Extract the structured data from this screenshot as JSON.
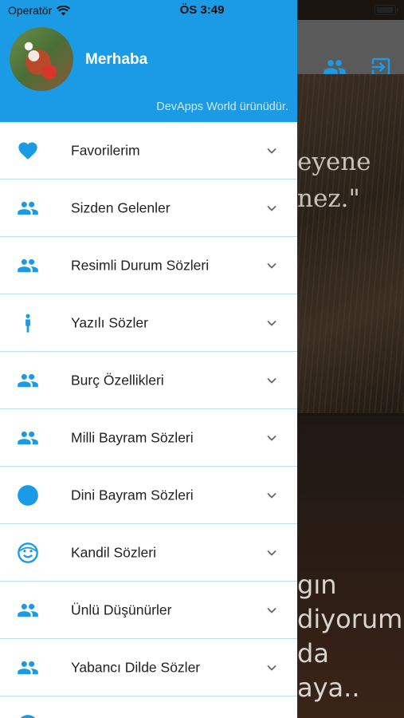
{
  "status_bar": {
    "carrier": "Operatör",
    "time": "ÖS 3:49"
  },
  "drawer": {
    "greeting": "Merhaba",
    "subtitle": "DevApps World ürünüdür.",
    "accent_color": "#1b9be6",
    "items": [
      {
        "label": "Favorilerim",
        "icon": "heart-icon"
      },
      {
        "label": "Sizden Gelenler",
        "icon": "people-icon"
      },
      {
        "label": "Resimli Durum Sözleri",
        "icon": "people-icon"
      },
      {
        "label": "Yazılı Sözler",
        "icon": "person-icon"
      },
      {
        "label": "Burç Özellikleri",
        "icon": "people-icon"
      },
      {
        "label": "Milli Bayram Sözleri",
        "icon": "people-icon"
      },
      {
        "label": "Dini Bayram Sözleri",
        "icon": "circle-icon"
      },
      {
        "label": "Kandil Sözleri",
        "icon": "face-icon"
      },
      {
        "label": "Ünlü Düşünürler",
        "icon": "people-icon"
      },
      {
        "label": "Yabancı Dilde Sözler",
        "icon": "people-icon"
      },
      {
        "label": "",
        "icon": "circle-icon"
      }
    ]
  },
  "background": {
    "quote1": "eyene\nnez.\"",
    "quote2": "gın\ndiyorum\nda\naya.."
  }
}
